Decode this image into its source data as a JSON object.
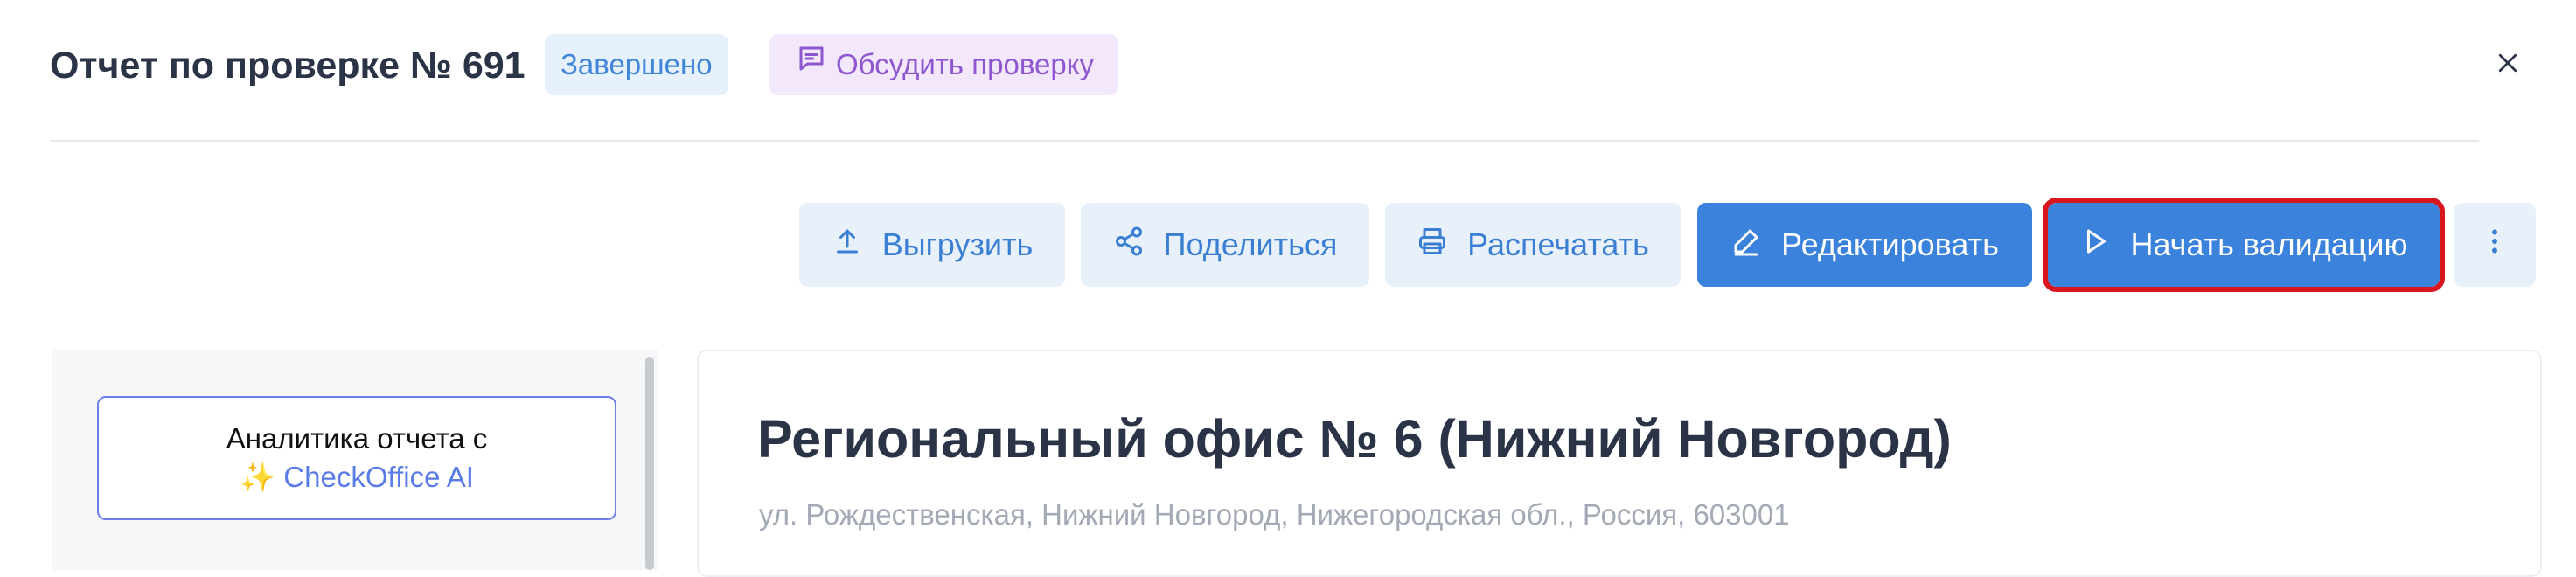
{
  "header": {
    "title": "Отчет по проверке № 691",
    "status_badge": "Завершено",
    "discuss_button": "Обсудить проверку",
    "icons": {
      "discuss": "message-square-icon",
      "close": "close-icon"
    }
  },
  "toolbar": {
    "export_label": "Выгрузить",
    "share_label": "Поделиться",
    "print_label": "Распечатать",
    "edit_label": "Редактировать",
    "validate_label": "Начать валидацию",
    "icons": {
      "export": "upload-icon",
      "share": "share-icon",
      "print": "printer-icon",
      "edit": "pencil-icon",
      "validate": "play-icon",
      "more": "more-vertical-icon"
    }
  },
  "sidebar": {
    "ai_card": {
      "line1": "Аналитика отчета с",
      "sparkle": "✨",
      "brand": "CheckOffice AI"
    }
  },
  "report": {
    "office_title": "Региональный офис № 6 (Нижний Новгород)",
    "address": "ул. Рождественская, Нижний Новгород, Нижегородская обл., Россия, 603001"
  },
  "colors": {
    "primary": "#3b82dd",
    "light_button": "#e8f1fa",
    "status_badge_bg": "#e7f1fb",
    "discuss_badge_bg": "#f2e7fb",
    "highlight_outline": "#d9161e",
    "text_dark": "#2b3447",
    "text_muted": "#a3aab5"
  }
}
